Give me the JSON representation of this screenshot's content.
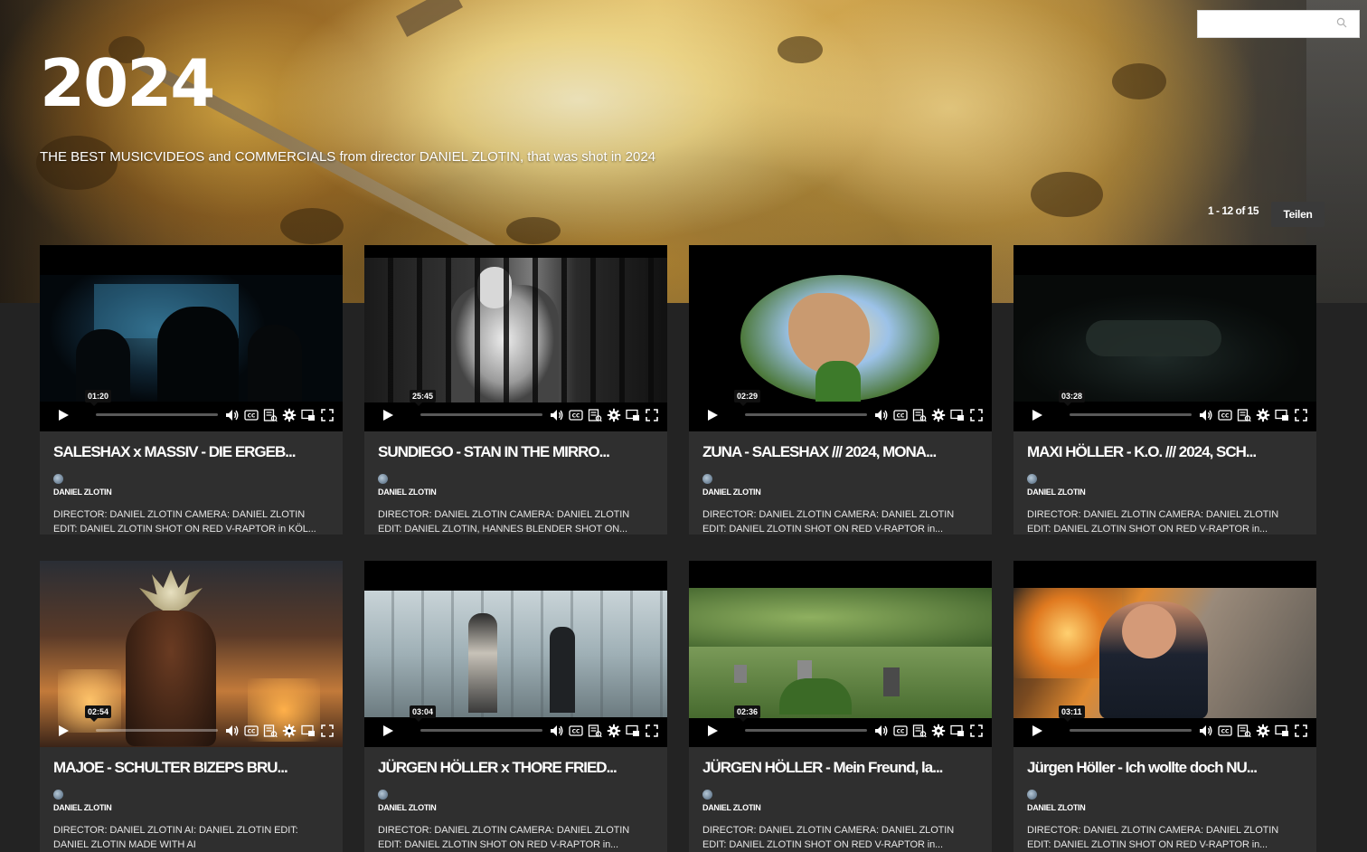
{
  "hero": {
    "title": "2024",
    "description": "THE BEST MUSICVIDEOS and COMMERCIALS from director DANIEL ZLOTIN, that was shot in 2024",
    "pager": "1 - 12 of 15",
    "share_label": "Teilen"
  },
  "search": {
    "placeholder": "",
    "value": ""
  },
  "videos": [
    {
      "title": "SALESHAX x MASSIV - DIE ERGEB...",
      "author": "DANIEL ZLOTIN",
      "duration": "01:20",
      "desc1": "DIRECTOR: DANIEL ZLOTIN CAMERA: DANIEL ZLOTIN",
      "desc2": "EDIT: DANIEL ZLOTIN SHOT ON RED V-RAPTOR in KÖL..."
    },
    {
      "title": "SUNDIEGO - STAN IN THE MIRRO...",
      "author": "DANIEL ZLOTIN",
      "duration": "25:45",
      "desc1": "DIRECTOR: DANIEL ZLOTIN CAMERA: DANIEL ZLOTIN",
      "desc2": "EDIT: DANIEL ZLOTIN, HANNES BLENDER SHOT ON..."
    },
    {
      "title": "ZUNA - SALESHAX /// 2024, MONA...",
      "author": "DANIEL ZLOTIN",
      "duration": "02:29",
      "desc1": "DIRECTOR: DANIEL ZLOTIN CAMERA: DANIEL ZLOTIN",
      "desc2": "EDIT: DANIEL ZLOTIN SHOT ON RED V-RAPTOR in..."
    },
    {
      "title": "MAXI HÖLLER - K.O. /// 2024, SCH...",
      "author": "DANIEL ZLOTIN",
      "duration": "03:28",
      "desc1": "DIRECTOR: DANIEL ZLOTIN CAMERA: DANIEL ZLOTIN",
      "desc2": "EDIT: DANIEL ZLOTIN SHOT ON RED V-RAPTOR in..."
    },
    {
      "title": "MAJOE - SCHULTER BIZEPS BRU...",
      "author": "DANIEL ZLOTIN",
      "duration": "02:54",
      "desc1": "DIRECTOR: DANIEL ZLOTIN AI: DANIEL ZLOTIN EDIT:",
      "desc2": "DANIEL ZLOTIN MADE WITH AI"
    },
    {
      "title": "JÜRGEN HÖLLER x THORE FRIED...",
      "author": "DANIEL ZLOTIN",
      "duration": "03:04",
      "desc1": "DIRECTOR: DANIEL ZLOTIN CAMERA: DANIEL ZLOTIN",
      "desc2": "EDIT: DANIEL ZLOTIN SHOT ON RED V-RAPTOR in..."
    },
    {
      "title": "JÜRGEN HÖLLER - Mein Freund, la...",
      "author": "DANIEL ZLOTIN",
      "duration": "02:36",
      "desc1": "DIRECTOR: DANIEL ZLOTIN CAMERA: DANIEL ZLOTIN",
      "desc2": "EDIT: DANIEL ZLOTIN SHOT ON RED V-RAPTOR in..."
    },
    {
      "title": "Jürgen Höller - Ich wollte doch NU...",
      "author": "DANIEL ZLOTIN",
      "duration": "03:11",
      "desc1": "DIRECTOR: DANIEL ZLOTIN CAMERA: DANIEL ZLOTIN",
      "desc2": "EDIT: DANIEL ZLOTIN SHOT ON RED V-RAPTOR in..."
    }
  ],
  "icons": [
    "play-icon",
    "volume-icon",
    "closed-captions-icon",
    "transcript-icon",
    "settings-icon",
    "picture-in-picture-icon",
    "fullscreen-icon",
    "search-icon"
  ]
}
